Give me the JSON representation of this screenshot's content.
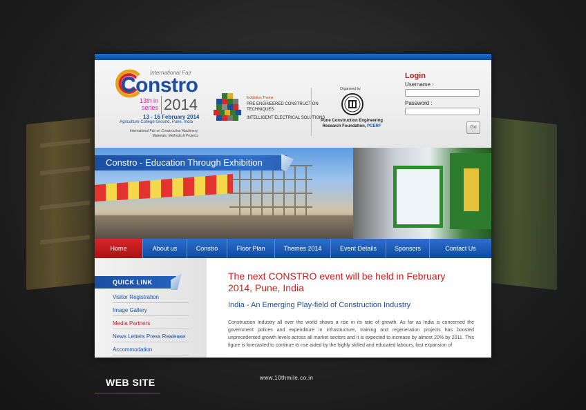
{
  "header": {
    "international_fair": "International Fair",
    "brand": "Constro",
    "series": "13th in series",
    "year": "2014",
    "dates": "13 - 16 February 2014",
    "venue": "Agriculture College Ground, Pune, India",
    "description": "International Fair on Construction Machinery, Materials, Methods & Projects",
    "theme_label": "Exhibition Theme",
    "theme_1": "PRE ENGINEERED CONSTRUCTION TECHNIQUES",
    "theme_2": "INTELLIGENT ELECTRICAL SOLUTIONS",
    "organised_by": "Organised by",
    "organizer": "Pune Construction Engineering Research Foundation,",
    "organizer_abbr": "PCERF"
  },
  "login": {
    "title": "Login",
    "username_label": "Username :",
    "password_label": "Password :",
    "go_label": "Go"
  },
  "banner": {
    "tagline": "Constro - Education Through Exhibition"
  },
  "nav": [
    {
      "label": "Home"
    },
    {
      "label": "About us"
    },
    {
      "label": "Constro"
    },
    {
      "label": "Floor Plan"
    },
    {
      "label": "Themes 2014"
    },
    {
      "label": "Event Details"
    },
    {
      "label": "Sponsors"
    },
    {
      "label": "Contact Us"
    }
  ],
  "quick_link": {
    "title": "QUICK LINK",
    "items": [
      {
        "label": "Visitor Registration"
      },
      {
        "label": "Image Gallery"
      },
      {
        "label": "Media Partners"
      },
      {
        "label": "News Letters Press Realease"
      },
      {
        "label": "Accommodation"
      }
    ]
  },
  "content": {
    "headline": "The next CONSTRO event will be held in February 2014, Pune, India",
    "subheading": "India - An Emerging Play-field of Construction Industry",
    "body": "Construction Industry all over the world shows a rise in its rate of growth. As far as India is concerned the government polices and expenditure in infrastructure, training and regeneration projects has boosted unprecedented growth levels across all market sectors and it is expected to increase by almost 20% by 2011. This figure is forecasted to continue to rise aided by the highly skilled and educated labours, fast expansion of"
  },
  "footer": {
    "label": "WEB SITE",
    "url": "www.10thmile.co.in"
  },
  "colors": {
    "brand_blue": "#1a4fa0",
    "accent_red": "#d02020",
    "nav_active": "#c41c20"
  }
}
